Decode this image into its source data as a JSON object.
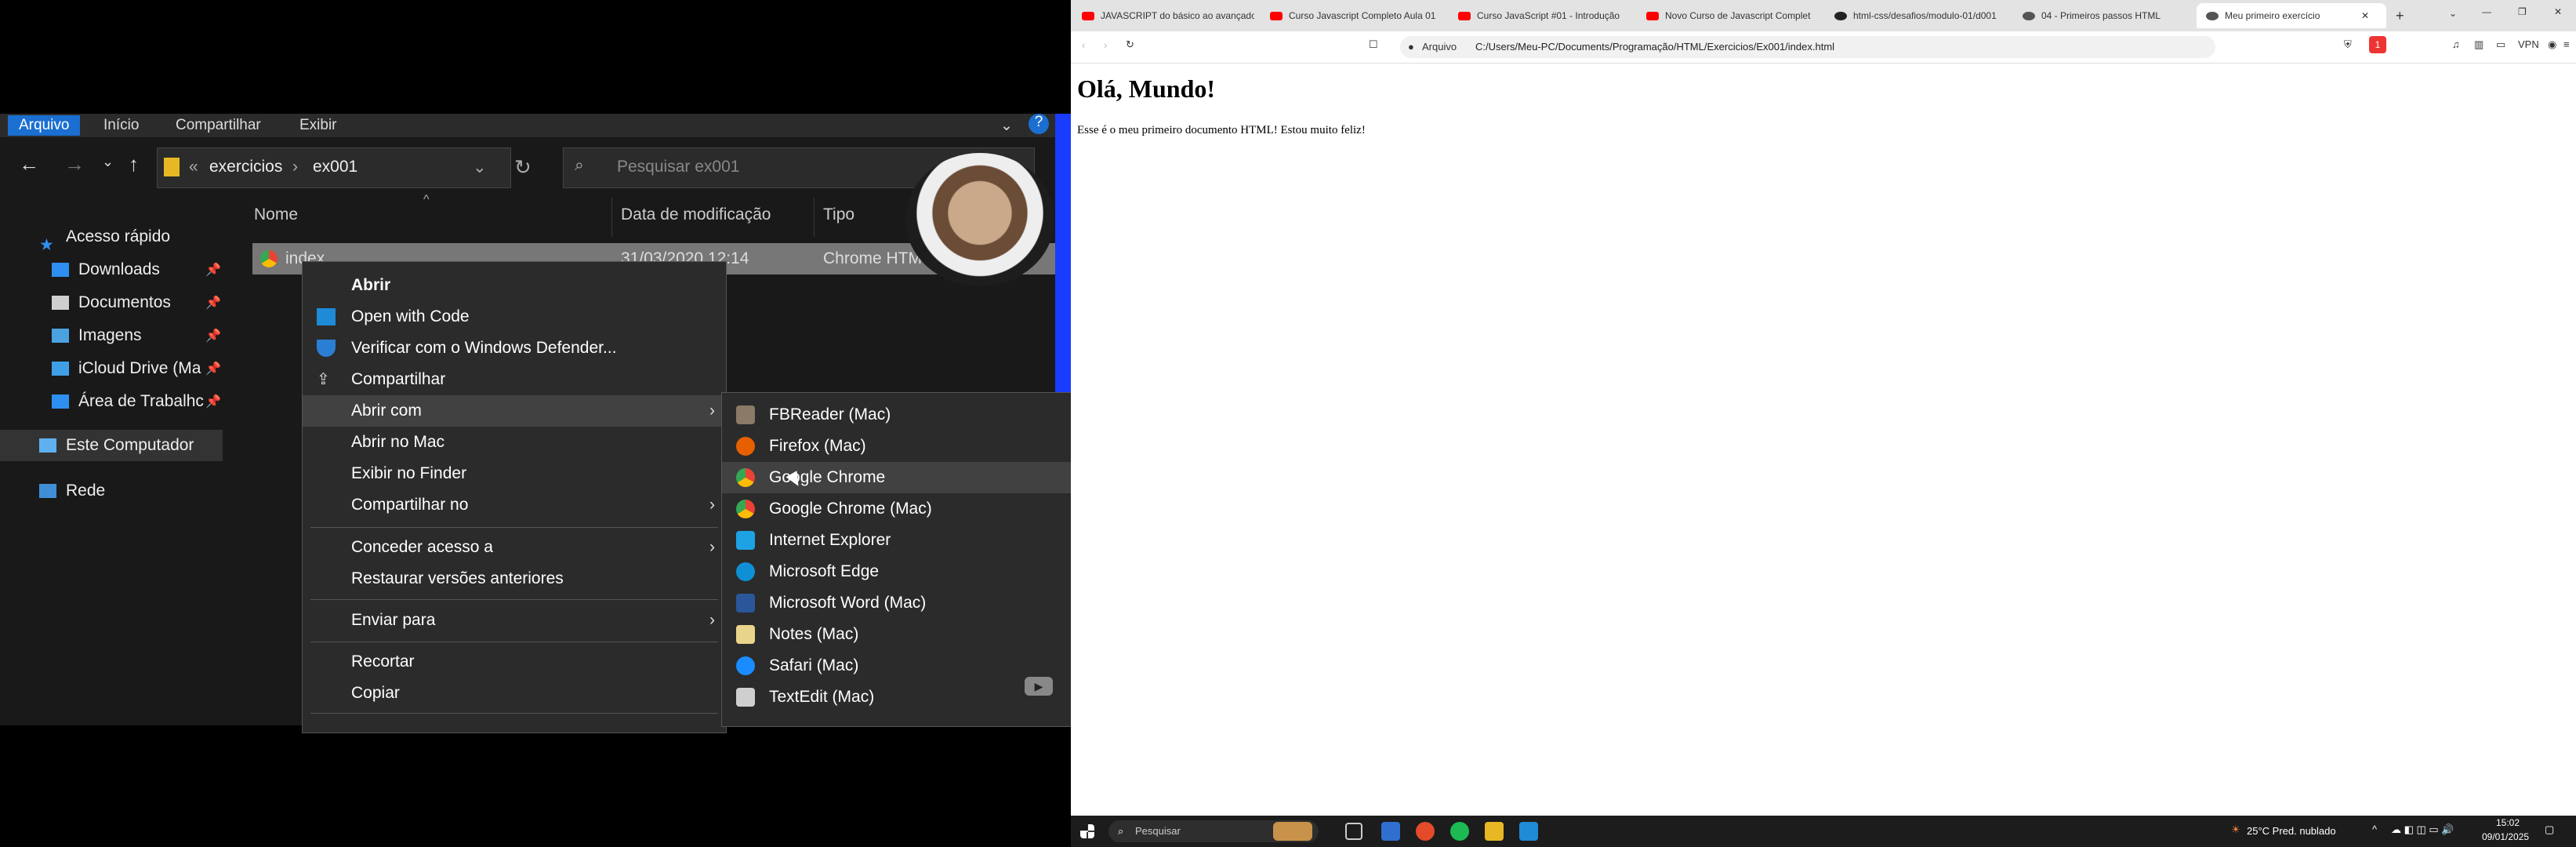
{
  "explorer": {
    "ribbon_tabs": [
      "Arquivo",
      "Início",
      "Compartilhar",
      "Exibir"
    ],
    "breadcrumb": [
      "exercicios",
      "ex001"
    ],
    "search_placeholder": "Pesquisar ex001",
    "sidebar": [
      {
        "label": "Acesso rápido",
        "icon": "star-icon"
      },
      {
        "label": "Downloads",
        "icon": "download-icon"
      },
      {
        "label": "Documentos",
        "icon": "documents-icon"
      },
      {
        "label": "Imagens",
        "icon": "images-icon"
      },
      {
        "label": "iCloud Drive (Ma",
        "icon": "icloud-icon"
      },
      {
        "label": "Área de Trabalhc",
        "icon": "desktop-icon"
      },
      {
        "label": "Este Computador",
        "icon": "computer-icon"
      },
      {
        "label": "Rede",
        "icon": "network-icon"
      }
    ],
    "columns": [
      "Nome",
      "Data de modificação",
      "Tipo"
    ],
    "file": {
      "name": "index",
      "date": "31/03/2020 12:14",
      "type": "Chrome HTM"
    }
  },
  "context_menu": [
    {
      "label": "Abrir",
      "bold": true
    },
    {
      "label": "Open with Code",
      "icon": "vscode-icon"
    },
    {
      "label": "Verificar com o Windows Defender...",
      "icon": "defender-icon"
    },
    {
      "label": "Compartilhar",
      "icon": "share-icon"
    },
    {
      "label": "Abrir com",
      "submenu": true
    },
    {
      "label": "Abrir no Mac"
    },
    {
      "label": "Exibir no Finder"
    },
    {
      "label": "Compartilhar no",
      "submenu": true
    },
    {
      "label": "Conceder acesso a",
      "submenu": true
    },
    {
      "label": "Restaurar versões anteriores"
    },
    {
      "label": "Enviar para",
      "submenu": true
    },
    {
      "label": "Recortar"
    },
    {
      "label": "Copiar"
    }
  ],
  "open_with": [
    {
      "label": "FBReader (Mac)",
      "color": "#8a7a66"
    },
    {
      "label": "Firefox (Mac)",
      "color": "#e66000"
    },
    {
      "label": "Google Chrome",
      "color": "#4285f4"
    },
    {
      "label": "Google Chrome (Mac)",
      "color": "#4285f4"
    },
    {
      "label": "Internet Explorer",
      "color": "#1ea2e3"
    },
    {
      "label": "Microsoft Edge",
      "color": "#0f8fd6"
    },
    {
      "label": "Microsoft Word (Mac)",
      "color": "#2b579a"
    },
    {
      "label": "Notes (Mac)",
      "color": "#e8d48a"
    },
    {
      "label": "Safari (Mac)",
      "color": "#1a8cff"
    },
    {
      "label": "TextEdit (Mac)",
      "color": "#cfcfcf"
    }
  ],
  "browser": {
    "tabs": [
      "JAVASCRIPT do básico ao avançado",
      "Curso Javascript Completo Aula 01",
      "Curso JavaScript #01 - Introdução",
      "Novo Curso de Javascript Complet",
      "html-css/desafios/modulo-01/d001",
      "04 - Primeiros passos HTML",
      "Meu primeiro exercício"
    ],
    "url_scheme": "Arquivo",
    "url": "C:/Users/Meu-PC/Documents/Programação/HTML/Exercicios/Ex001/index.html",
    "vpn": "VPN",
    "badge": "1"
  },
  "page": {
    "heading": "Olá, Mundo!",
    "paragraph": "Esse é o meu primeiro documento HTML! Estou muito feliz!"
  },
  "taskbar": {
    "search": "Pesquisar",
    "weather": "25°C  Pred. nublado",
    "time": "15:02",
    "date": "09/01/2025"
  }
}
